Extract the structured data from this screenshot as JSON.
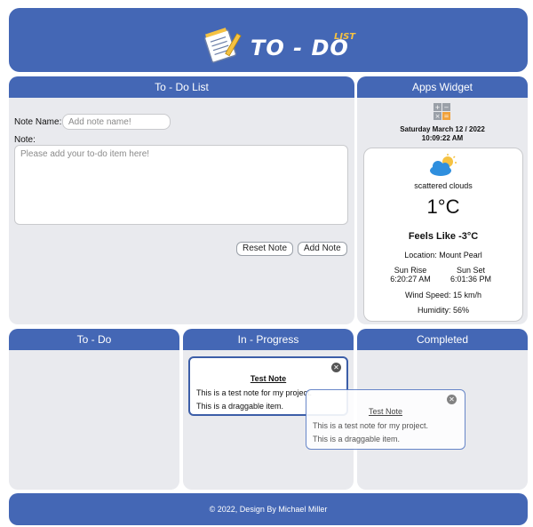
{
  "header": {
    "logo_title": "TO - DO",
    "logo_sub": "LIST"
  },
  "todo_form": {
    "title": "To - Do List",
    "note_name_label": "Note Name:",
    "note_name_placeholder": "Add note name!",
    "note_name_value": "",
    "note_label": "Note:",
    "note_placeholder": "Please add your to-do item here!",
    "note_value": "",
    "reset_button": "Reset Note",
    "add_button": "Add Note"
  },
  "widget": {
    "title": "Apps Widget",
    "icon": "calculator-icon",
    "date": "Saturday March 12 / 2022",
    "time": "10:09:22 AM",
    "weather": {
      "icon": "partly-cloudy-icon",
      "description": "scattered clouds",
      "temperature": "1°C",
      "feels_like": "Feels Like -3°C",
      "location": "Location: Mount Pearl",
      "sunrise_label": "Sun Rise",
      "sunrise_time": "6:20:27 AM",
      "sunset_label": "Sun Set",
      "sunset_time": "6:01:36 PM",
      "wind": "Wind Speed: 15 km/h",
      "humidity": "Humidity: 56%"
    }
  },
  "columns": {
    "todo": "To - Do",
    "in_progress": "In - Progress",
    "completed": "Completed"
  },
  "notes": [
    {
      "title": "Test Note",
      "line1": "This is a test note for my project.",
      "line2": "This is a draggable item."
    },
    {
      "title": "Test Note",
      "line1": "This is a test note for my project.",
      "line2": "This is a draggable item."
    }
  ],
  "footer": {
    "text": "© 2022, Design By Michael Miller"
  },
  "colors": {
    "primary": "#4467b5",
    "panel": "#e9eaee",
    "logo_accent": "#f5c242"
  }
}
